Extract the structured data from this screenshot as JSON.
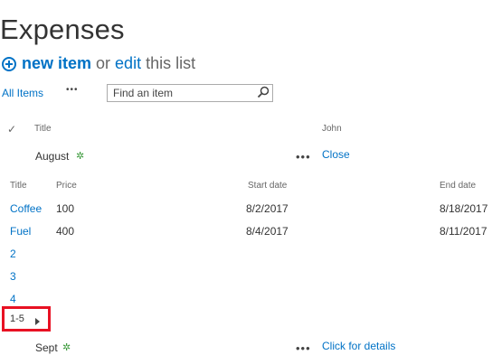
{
  "page": {
    "title": "Expenses"
  },
  "command_bar": {
    "new_item": "new item",
    "or": "or",
    "edit": "edit",
    "this_list": "this list"
  },
  "view": {
    "name": "All Items",
    "more": "•••"
  },
  "search": {
    "placeholder": "Find an item"
  },
  "columns": {
    "check": "✓",
    "title": "Title",
    "john": "John"
  },
  "groups": [
    {
      "name": "August",
      "new_marker": "✲",
      "more": "•••",
      "john_value": "Close"
    },
    {
      "name": "Sept",
      "new_marker": "✲",
      "more": "•••",
      "john_value": "Click for details"
    }
  ],
  "sub_table": {
    "headers": {
      "title": "Title",
      "price": "Price",
      "start_date": "Start date",
      "end_date": "End date"
    },
    "rows": [
      {
        "title": "Coffee",
        "price": "100",
        "start_date": "8/2/2017",
        "end_date": "8/18/2017"
      },
      {
        "title": "Fuel",
        "price": "400",
        "start_date": "8/4/2017",
        "end_date": "8/11/2017"
      }
    ],
    "pages": [
      "2",
      "3",
      "4"
    ],
    "paging": {
      "range": "1-5"
    }
  }
}
